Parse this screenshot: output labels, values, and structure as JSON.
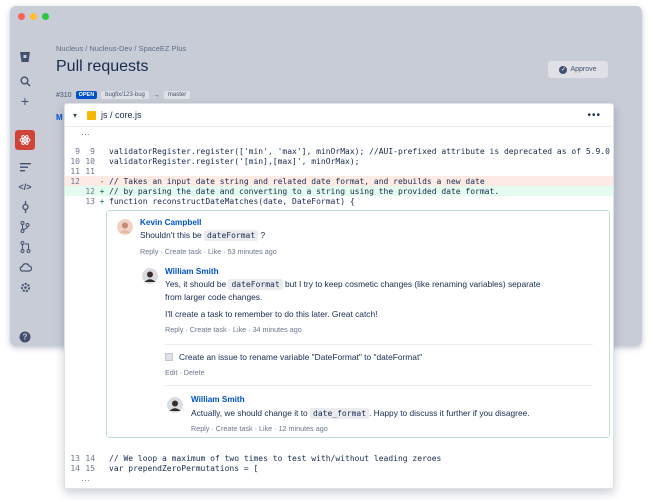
{
  "window": {
    "dots": [
      "#ff5f57",
      "#febc2e",
      "#28c840"
    ]
  },
  "breadcrumb": [
    "Nucleus",
    "/",
    "Nucleus-Dev",
    "/",
    "SpaceEZ Plus"
  ],
  "page_title": "Pull requests",
  "approve_label": "Approve",
  "pr": {
    "number": "#310",
    "status": "OPEN",
    "source_branch": "bugfix/123-bug",
    "arrow": "→",
    "target_branch": "master"
  },
  "file": {
    "path": "js / core.js",
    "more": "•••"
  },
  "code_top": [
    {
      "old": "9",
      "new": "9",
      "mark": "",
      "type": "ctx",
      "text": "validatorRegister.register(['min', 'max'], minOrMax); //AUI-prefixed attribute is deprecated as of 5.9.0"
    },
    {
      "old": "10",
      "new": "10",
      "mark": "",
      "type": "ctx",
      "text": "validatorRegister.register('[min],[max]', minOrMax);"
    },
    {
      "old": "11",
      "new": "11",
      "mark": "",
      "type": "ctx",
      "text": ""
    },
    {
      "old": "12",
      "new": "",
      "mark": "-",
      "type": "del",
      "text": "// Takes an input date string and related date format, and rebuilds a new date"
    },
    {
      "old": "",
      "new": "12",
      "mark": "+",
      "type": "add",
      "text": "// by parsing the date and converting to a string using the provided date format."
    },
    {
      "old": "",
      "new": "13",
      "mark": "+",
      "type": "add",
      "text": "function reconstructDateMatches(date, DateFormat) {"
    }
  ],
  "code_bottom": [
    {
      "old": "13",
      "new": "14",
      "mark": "",
      "type": "ctx",
      "text": "// We loop a maximum of two times to test with/without leading zeroes"
    },
    {
      "old": "14",
      "new": "15",
      "mark": "",
      "type": "ctx",
      "text": "var prependZeroPermutations = ["
    }
  ],
  "ellipsis": "…",
  "comments": {
    "c1": {
      "author": "Kevin Campbell",
      "text_before": "Shouldn't this be",
      "code": "dateFormat",
      "text_after": "?",
      "reply": "Reply",
      "create_task": "Create task",
      "like": "Like",
      "time": "53 minutes ago",
      "sep": "·"
    },
    "c2": {
      "author": "William Smith",
      "text_before": "Yes, it should be",
      "code": "dateFormat",
      "text_after": "but I try to keep cosmetic changes (like renaming variables) separate",
      "line2": "from larger code changes.",
      "para2": "I'll create a task to remember to do this later. Great catch!",
      "reply": "Reply",
      "create_task": "Create task",
      "like": "Like",
      "time": "34 minutes ago",
      "sep": "·"
    },
    "task": {
      "text": "Create an issue to rename variable \"DateFormat\" to \"dateFormat\"",
      "edit": "Edit",
      "delete": "Delete",
      "sep": "·"
    },
    "c3": {
      "author": "William Smith",
      "text_before": "Actually, we should change it to",
      "code": "date_format",
      "text_after": ". Happy to discuss it further if you disagree.",
      "reply": "Reply",
      "create_task": "Create task",
      "like": "Like",
      "time": "12 minutes ago",
      "sep": "·"
    }
  },
  "tab_hint": "M"
}
